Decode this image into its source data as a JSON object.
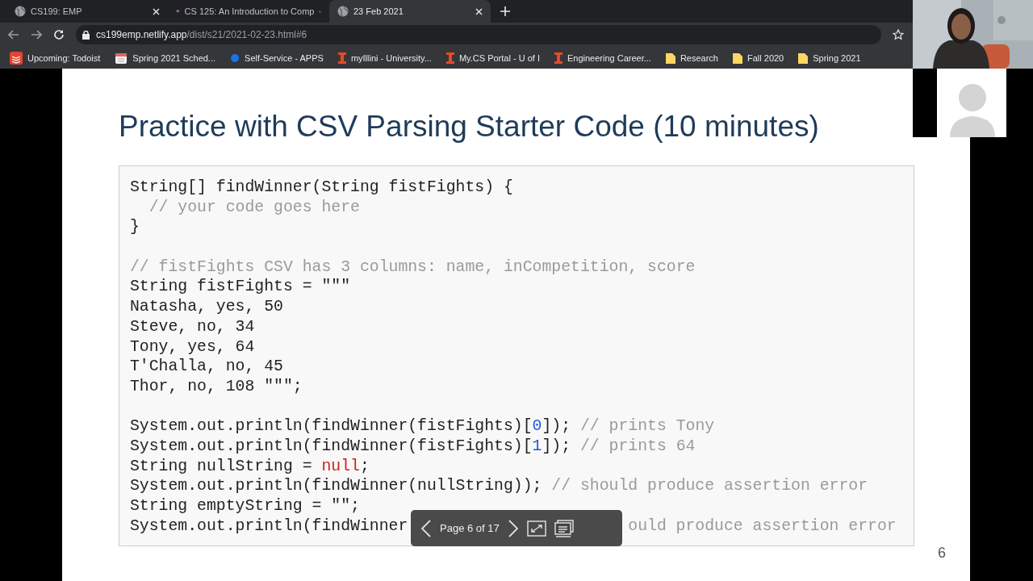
{
  "browser": {
    "tabs": [
      {
        "title": "CS199: EMP",
        "selected": false
      },
      {
        "title": "CS 125: An Introduction to Comp",
        "selected": false
      },
      {
        "title": "23 Feb 2021",
        "selected": true
      }
    ],
    "url": {
      "host": "cs199emp.netlify.app",
      "path": "/dist/s21/2021-02-23.html#6"
    },
    "bookmarks": [
      "Upcoming: Todoist",
      "Spring 2021 Sched...",
      "Self-Service - APPS",
      "myIllini - University...",
      "My.CS Portal - U of I",
      "Engineering Career...",
      "Research",
      "Fall 2020",
      "Spring 2021"
    ]
  },
  "slide": {
    "title": "Practice with CSV Parsing Starter Code (10 minutes)",
    "code": [
      {
        "kind": "code",
        "tokens": [
          {
            "kind": "plain",
            "s": "String[] findWinner(String fistFights) {"
          }
        ]
      },
      {
        "kind": "code",
        "tokens": [
          {
            "kind": "comment",
            "s": "  // your code goes here"
          }
        ]
      },
      {
        "kind": "code",
        "tokens": [
          {
            "kind": "plain",
            "s": "}"
          }
        ]
      },
      {
        "kind": "blank"
      },
      {
        "kind": "code",
        "tokens": [
          {
            "kind": "comment",
            "s": "// fistFights CSV has 3 columns: name, inCompetition, score"
          }
        ]
      },
      {
        "kind": "code",
        "tokens": [
          {
            "kind": "plain",
            "s": "String fistFights = \"\"\""
          }
        ]
      },
      {
        "kind": "code",
        "tokens": [
          {
            "kind": "plain",
            "s": "Natasha, yes, 50"
          }
        ]
      },
      {
        "kind": "code",
        "tokens": [
          {
            "kind": "plain",
            "s": "Steve, no, 34"
          }
        ]
      },
      {
        "kind": "code",
        "tokens": [
          {
            "kind": "plain",
            "s": "Tony, yes, 64"
          }
        ]
      },
      {
        "kind": "code",
        "tokens": [
          {
            "kind": "plain",
            "s": "T'Challa, no, 45"
          }
        ]
      },
      {
        "kind": "code",
        "tokens": [
          {
            "kind": "plain",
            "s": "Thor, no, 108 \"\"\";"
          }
        ]
      },
      {
        "kind": "blank"
      },
      {
        "kind": "code",
        "tokens": [
          {
            "kind": "plain",
            "s": "System.out.println(findWinner(fistFights)["
          },
          {
            "kind": "number",
            "s": "0"
          },
          {
            "kind": "plain",
            "s": "]); "
          },
          {
            "kind": "comment",
            "s": "// prints Tony"
          }
        ]
      },
      {
        "kind": "code",
        "tokens": [
          {
            "kind": "plain",
            "s": "System.out.println(findWinner(fistFights)["
          },
          {
            "kind": "number",
            "s": "1"
          },
          {
            "kind": "plain",
            "s": "]); "
          },
          {
            "kind": "comment",
            "s": "// prints 64"
          }
        ]
      },
      {
        "kind": "code",
        "tokens": [
          {
            "kind": "plain",
            "s": "String nullString = "
          },
          {
            "kind": "keyword",
            "s": "null"
          },
          {
            "kind": "plain",
            "s": ";"
          }
        ]
      },
      {
        "kind": "code",
        "tokens": [
          {
            "kind": "plain",
            "s": "System.out.println(findWinner(nullString)); "
          },
          {
            "kind": "comment",
            "s": "// should produce assertion error"
          }
        ]
      },
      {
        "kind": "code",
        "tokens": [
          {
            "kind": "plain",
            "s": "String emptyString = \"\";"
          }
        ]
      },
      {
        "kind": "covered",
        "before": "System.out.println(findWinner",
        "after": "ould produce assertion error"
      }
    ],
    "page_indicator": "Page 6 of 17",
    "slide_number": "6"
  },
  "video": [
    {
      "kind": "picture"
    },
    {
      "kind": "avatar"
    }
  ]
}
